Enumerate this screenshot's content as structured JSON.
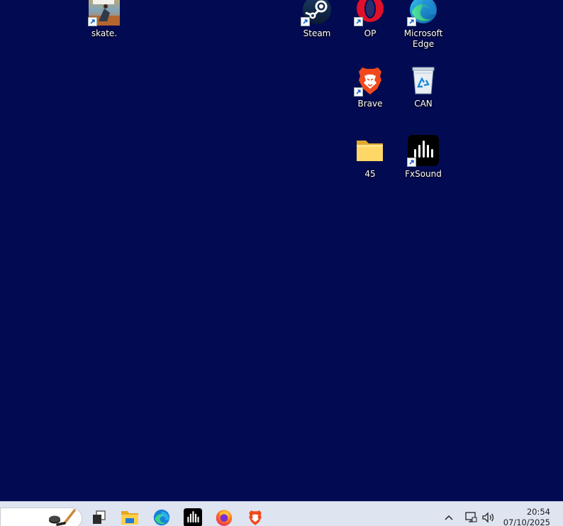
{
  "desktop": {
    "background_color": "#020b52",
    "icons": {
      "skate": {
        "label": "skate.",
        "icon": "skate-game-icon",
        "shortcut": true
      },
      "steam": {
        "label": "Steam",
        "icon": "steam-icon",
        "shortcut": true
      },
      "opera": {
        "label": "OP",
        "icon": "opera-icon",
        "shortcut": true
      },
      "edge": {
        "label": "Microsoft Edge",
        "icon": "edge-icon",
        "shortcut": true
      },
      "brave": {
        "label": "Brave",
        "icon": "brave-icon",
        "shortcut": true
      },
      "recycle_bin": {
        "label": "CAN",
        "icon": "recycle-bin-icon",
        "shortcut": false
      },
      "folder": {
        "label": "45",
        "icon": "folder-icon",
        "shortcut": false
      },
      "fxsound": {
        "label": "FxSound",
        "icon": "fxsound-icon",
        "shortcut": true
      }
    }
  },
  "taskbar": {
    "search_icon": "hockey-stick-puck-icon",
    "pinned": [
      {
        "name": "task-view",
        "icon": "task-view-icon"
      },
      {
        "name": "file-explorer",
        "icon": "folder-icon"
      },
      {
        "name": "edge",
        "icon": "edge-icon"
      },
      {
        "name": "fxsound",
        "icon": "fxsound-icon"
      },
      {
        "name": "firefox",
        "icon": "firefox-icon"
      },
      {
        "name": "brave",
        "icon": "brave-icon"
      }
    ],
    "tray": {
      "chevron_icon": "chevron-up-icon",
      "network_icon": "network-icon",
      "volume_icon": "volume-icon",
      "time": "20:54",
      "date": "07/10/2025"
    }
  }
}
